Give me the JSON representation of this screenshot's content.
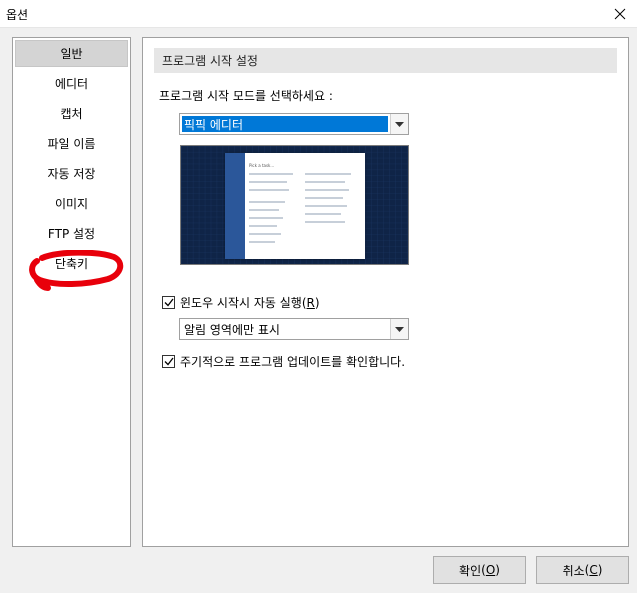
{
  "window": {
    "title": "옵션",
    "close_icon": "close-icon"
  },
  "sidebar": {
    "items": [
      {
        "label": "일반",
        "selected": true
      },
      {
        "label": "에디터"
      },
      {
        "label": "캡처"
      },
      {
        "label": "파일 이름"
      },
      {
        "label": "자동 저장"
      },
      {
        "label": "이미지"
      },
      {
        "label": "FTP 설정"
      },
      {
        "label": "단축키"
      }
    ],
    "highlight_color": "#e8000b"
  },
  "panel": {
    "section_title": "프로그램 시작 설정",
    "prompt": "프로그램 시작 모드를 선택하세요 :",
    "mode_select": {
      "value": "픽픽 에디터"
    },
    "preview": {
      "title": "Pick a task..."
    },
    "autorun": {
      "label": "윈도우 시작시 자동 실행",
      "mnemonic": "R",
      "checked": true
    },
    "tray_select": {
      "value": "알림 영역에만 표시"
    },
    "update_check": {
      "label": "주기적으로 프로그램 업데이트를 확인합니다.",
      "checked": true
    }
  },
  "buttons": {
    "ok": {
      "label": "확인",
      "mnemonic": "O"
    },
    "cancel": {
      "label": "취소",
      "mnemonic": "C"
    }
  },
  "colors": {
    "selection": "#0078d7",
    "preview_bg": "#0f2447",
    "preview_rail": "#2b579a"
  }
}
